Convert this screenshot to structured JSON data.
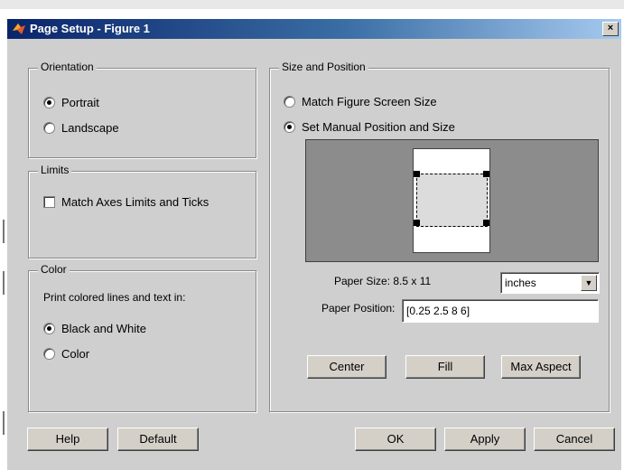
{
  "window": {
    "title": "Page Setup - Figure 1",
    "close_glyph": "×",
    "app_icon": "matlab-logo-icon"
  },
  "orientation": {
    "legend": "Orientation",
    "options": [
      {
        "label": "Portrait",
        "selected": true
      },
      {
        "label": "Landscape",
        "selected": false
      }
    ]
  },
  "limits": {
    "legend": "Limits",
    "match_axes": {
      "label": "Match Axes Limits and Ticks",
      "checked": false
    }
  },
  "color": {
    "legend": "Color",
    "prompt": "Print colored lines and text in:",
    "options": [
      {
        "label": "Black and White",
        "selected": true
      },
      {
        "label": "Color",
        "selected": false
      }
    ]
  },
  "size_position": {
    "legend": "Size and Position",
    "options": [
      {
        "label": "Match Figure Screen Size",
        "selected": false
      },
      {
        "label": "Set Manual Position and Size",
        "selected": true
      }
    ],
    "paper_size_label": "Paper Size: 8.5 x 11",
    "units_value": "inches",
    "paper_position_label": "Paper Position:",
    "paper_position_value": "[0.25 2.5 8 6]",
    "buttons": {
      "center": "Center",
      "fill": "Fill",
      "max_aspect": "Max Aspect"
    }
  },
  "footer": {
    "help": "Help",
    "default": "Default",
    "ok": "OK",
    "apply": "Apply",
    "cancel": "Cancel"
  },
  "colors": {
    "titlebar_start": "#0a246a",
    "titlebar_end": "#a6caf0",
    "dialog_bg": "#cfcfcf",
    "preview_bg": "#8c8c8c"
  }
}
